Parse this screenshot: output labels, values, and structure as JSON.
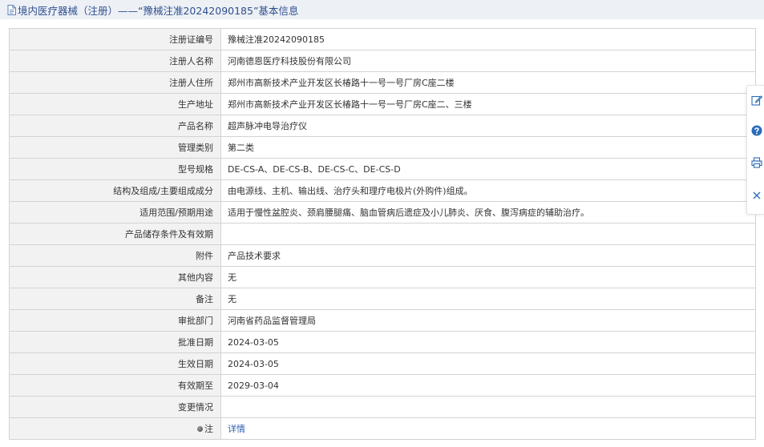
{
  "header": {
    "title": "境内医疗器械（注册）——“豫械注准20242090185”基本信息"
  },
  "rows": [
    {
      "label": "注册证编号",
      "value": "豫械注准20242090185"
    },
    {
      "label": "注册人名称",
      "value": "河南德恩医疗科技股份有限公司"
    },
    {
      "label": "注册人住所",
      "value": "郑州市高新技术产业开发区长椿路十一号一号厂房C座二楼"
    },
    {
      "label": "生产地址",
      "value": "郑州市高新技术产业开发区长椿路十一号一号厂房C座二、三楼"
    },
    {
      "label": "产品名称",
      "value": "超声脉冲电导治疗仪"
    },
    {
      "label": "管理类别",
      "value": "第二类"
    },
    {
      "label": "型号规格",
      "value": "DE-CS-A、DE-CS-B、DE-CS-C、DE-CS-D"
    },
    {
      "label": "结构及组成/主要组成成分",
      "value": "由电源线、主机、输出线、治疗头和理疗电极片(外购件)组成。"
    },
    {
      "label": "适用范围/预期用途",
      "value": "适用于慢性盆腔炎、颈肩腰腿痛、脑血管病后遗症及小儿肺炎、厌食、腹泻病症的辅助治疗。"
    },
    {
      "label": "产品储存条件及有效期",
      "value": ""
    },
    {
      "label": "附件",
      "value": "产品技术要求"
    },
    {
      "label": "其他内容",
      "value": "无"
    },
    {
      "label": "备注",
      "value": "无"
    },
    {
      "label": "审批部门",
      "value": "河南省药品监督管理局"
    },
    {
      "label": "批准日期",
      "value": "2024-03-05"
    },
    {
      "label": "生效日期",
      "value": "2024-03-05"
    },
    {
      "label": "有效期至",
      "value": "2029-03-04"
    },
    {
      "label": "变更情况",
      "value": ""
    }
  ],
  "note": {
    "label": "注",
    "link": "详情"
  },
  "side_tools": [
    {
      "icon": "edit-icon"
    },
    {
      "icon": "help-icon"
    },
    {
      "icon": "print-icon"
    },
    {
      "icon": "close-icon"
    }
  ],
  "colors": {
    "header_bg": "#edf0f5",
    "header_text": "#2f4f8f",
    "label_bg": "#f2f2f2",
    "border": "#d3d3d3",
    "link": "#2a5db0",
    "tool_icon": "#2a6bb8"
  }
}
